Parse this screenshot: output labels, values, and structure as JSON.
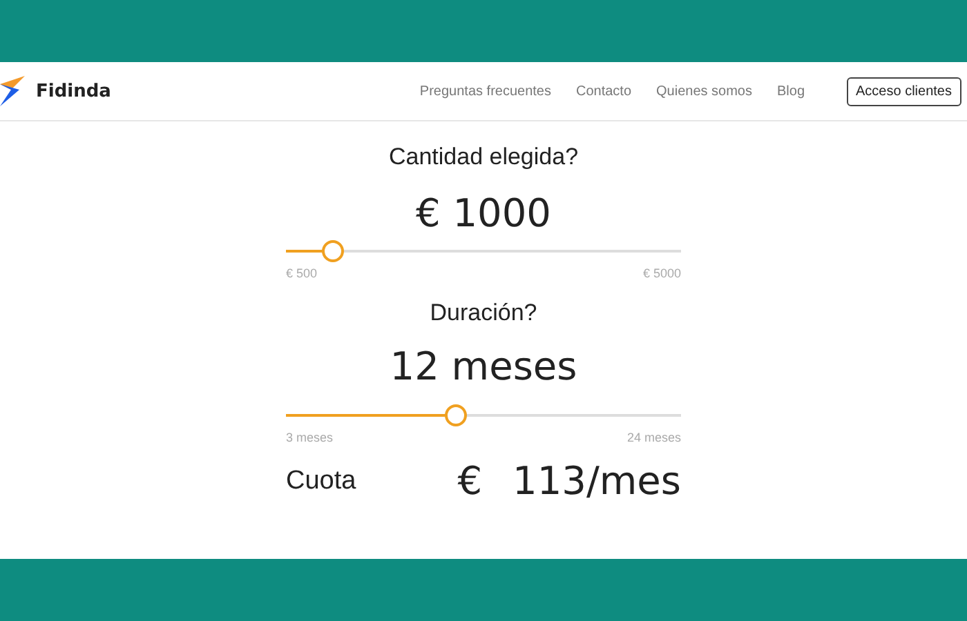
{
  "brand": {
    "name": "Fidinda"
  },
  "nav": [
    {
      "label": "Preguntas frecuentes"
    },
    {
      "label": "Contacto"
    },
    {
      "label": "Quienes somos"
    },
    {
      "label": "Blog"
    }
  ],
  "cta": {
    "label": "Acceso clientes"
  },
  "sliders": [
    {
      "question": "Cantidad elegida?",
      "value": "€ 1000",
      "level": 0.12,
      "min": "€ 500",
      "max": "€ 5000"
    },
    {
      "question": "Duración?",
      "value": "12 meses",
      "level": 0.43,
      "min": "3 meses",
      "max": "24 meses"
    }
  ],
  "result": {
    "label": "Cuota",
    "currency": "€",
    "amount": "113/mes"
  }
}
